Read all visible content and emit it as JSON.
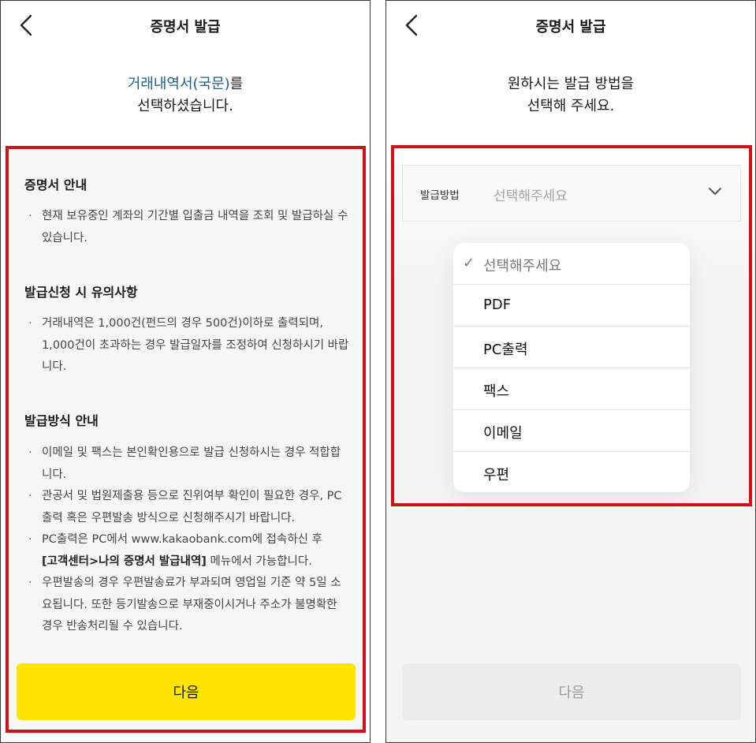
{
  "left": {
    "title": "증명서 발급",
    "intro_highlight": "거래내역서(국문)",
    "intro_suffix": "를",
    "intro_line2": "선택하셨습니다.",
    "sections": [
      {
        "title": "증명서 안내",
        "items": [
          "현재 보유중인 계좌의 기간별 입출금 내역을 조회 및 발급하실 수 있습니다."
        ]
      },
      {
        "title": "발급신청 시 유의사항",
        "items": [
          "거래내역은 1,000건(펀드의 경우 500건)이하로 출력되며, 1,000건이 초과하는 경우 발급일자를 조정하여 신청하시기 바랍니다."
        ]
      },
      {
        "title": "발급방식 안내",
        "items": [
          "이메일 및 팩스는 본인확인용으로 발급 신청하시는 경우 적합합니다.",
          "관공서 및 법원제출용 등으로 진위여부 확인이 필요한 경우, PC출력 혹은 우편발송 방식으로 신청해주시기 바랍니다.",
          "PC출력은 PC에서 www.kakaobank.com에 접속하신 후",
          "[고객센터>나의 증명서 발급내역]",
          " 메뉴에서 가능합니다.",
          "우편발송의 경우 우편발송료가 부과되며 영업일 기준 약 5일 소요됩니다. 또한 등기발송으로 부재중이시거나 주소가 불명확한 경우 반송처리될 수 있습니다."
        ]
      }
    ],
    "next_label": "다음"
  },
  "right": {
    "title": "증명서 발급",
    "intro_line1": "원하시는 발급 방법을",
    "intro_line2": "선택해 주세요.",
    "method_label": "발급방법",
    "method_placeholder": "선택해주세요",
    "options": [
      "선택해주세요",
      "PDF",
      "PC출력",
      "팩스",
      "이메일",
      "우편"
    ],
    "check_mark": "✓",
    "next_label": "다음"
  },
  "colors": {
    "highlight_text": "#1f5e85",
    "primary_button": "#fee500",
    "annotation_frame": "#d0101b",
    "disabled_button": "#ececec"
  },
  "icons": [
    "back-arrow-icon",
    "chevron-down-icon",
    "checkmark-icon"
  ]
}
